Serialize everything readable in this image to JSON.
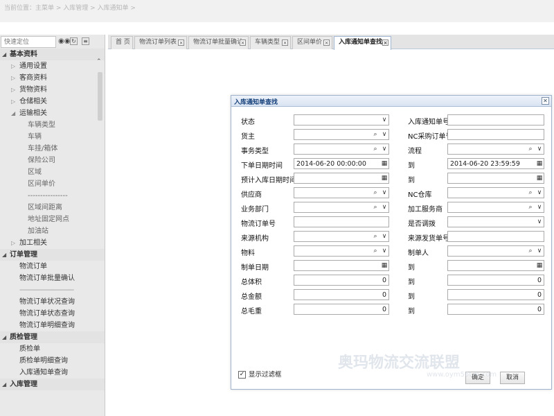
{
  "breadcrumb": "当前位置：主菜单 > 入库管理 > 入库通知单 >",
  "sidebar": {
    "quick_placeholder": "快速定位",
    "groups": [
      {
        "label": "基本资料",
        "items": [
          {
            "label": "通用设置"
          },
          {
            "label": "客商资料"
          },
          {
            "label": "货物资料"
          },
          {
            "label": "仓储相关"
          },
          {
            "label": "运输相关",
            "expanded": true,
            "children": [
              "车辆类型",
              "车辆",
              "车挂/箱体",
              "保险公司",
              "区域",
              "区间单价",
              "----------------",
              "区域间距离",
              "地址固定网点",
              "加油站"
            ]
          },
          {
            "label": "加工相关"
          }
        ]
      },
      {
        "label": "订单管理",
        "links": [
          "物流订单",
          "物流订单批量确认",
          "------------------------------",
          "物流订单状况查询",
          "物流订单状态查询",
          "物流订单明细查询"
        ]
      },
      {
        "label": "质检管理",
        "links": [
          "质检单",
          "质检单明细查询",
          "入库通知单查询"
        ]
      },
      {
        "label": "入库管理",
        "links": []
      }
    ]
  },
  "tabs": [
    {
      "label": "首 页",
      "closable": false
    },
    {
      "label": "物流订单列表",
      "closable": true
    },
    {
      "label": "物流订单批量确认",
      "closable": true
    },
    {
      "label": "车辆类型",
      "closable": true
    },
    {
      "label": "区间单价",
      "closable": true
    },
    {
      "label": "入库通知单查找",
      "closable": true,
      "active": true
    }
  ],
  "dialog": {
    "title": "入库通知单查找",
    "rows": [
      {
        "left": {
          "label": "状态",
          "value": "",
          "kind": "select"
        },
        "right": {
          "label": "入库通知单号",
          "value": "",
          "kind": "text"
        }
      },
      {
        "left": {
          "label": "货主",
          "value": "",
          "kind": "lookup"
        },
        "right": {
          "label": "NC采购订单号",
          "value": "",
          "kind": "text"
        }
      },
      {
        "left": {
          "label": "事务类型",
          "value": "",
          "kind": "lookup"
        },
        "right": {
          "label": "流程",
          "value": "",
          "kind": "lookup"
        }
      },
      {
        "left": {
          "label": "下单日期时间",
          "value": "2014-06-20 00:00:00",
          "kind": "date"
        },
        "right": {
          "label": "到",
          "value": "2014-06-20 23:59:59",
          "kind": "date"
        }
      },
      {
        "left": {
          "label": "预计入库日期时间",
          "value": "",
          "kind": "date"
        },
        "right": {
          "label": "到",
          "value": "",
          "kind": "date"
        }
      },
      {
        "left": {
          "label": "供应商",
          "value": "",
          "kind": "lookup"
        },
        "right": {
          "label": "NC仓库",
          "value": "",
          "kind": "lookup"
        }
      },
      {
        "left": {
          "label": "业务部门",
          "value": "",
          "kind": "lookup"
        },
        "right": {
          "label": "加工服务商",
          "value": "",
          "kind": "lookup"
        }
      },
      {
        "left": {
          "label": "物流订单号",
          "value": "",
          "kind": "text"
        },
        "right": {
          "label": "是否调拨",
          "value": "",
          "kind": "select"
        }
      },
      {
        "left": {
          "label": "来源机构",
          "value": "",
          "kind": "lookup"
        },
        "right": {
          "label": "来源发货单号",
          "value": "",
          "kind": "text"
        }
      },
      {
        "left": {
          "label": "物料",
          "value": "",
          "kind": "lookup"
        },
        "right": {
          "label": "制单人",
          "value": "",
          "kind": "lookup"
        }
      },
      {
        "left": {
          "label": "制单日期",
          "value": "",
          "kind": "date"
        },
        "right": {
          "label": "到",
          "value": "",
          "kind": "date"
        }
      },
      {
        "left": {
          "label": "总体积",
          "value": "0",
          "kind": "number"
        },
        "right": {
          "label": "到",
          "value": "0",
          "kind": "number"
        }
      },
      {
        "left": {
          "label": "总金额",
          "value": "0",
          "kind": "number"
        },
        "right": {
          "label": "到",
          "value": "0",
          "kind": "number"
        }
      },
      {
        "left": {
          "label": "总毛重",
          "value": "0",
          "kind": "number"
        },
        "right": {
          "label": "到",
          "value": "0",
          "kind": "number"
        }
      }
    ],
    "show_filter_label": "显示过滤框",
    "show_filter_checked": true,
    "confirm_label": "确定",
    "cancel_label": "取消"
  },
  "watermark": {
    "text": "奥玛物流交流联盟",
    "url": "www.oym56Lm.com"
  },
  "icons": {
    "binoculars": "binoculars-icon",
    "lookup": "magnifier-icon",
    "dropdown": "chevron-down-icon",
    "calendar": "calendar-icon",
    "close": "close-icon"
  }
}
